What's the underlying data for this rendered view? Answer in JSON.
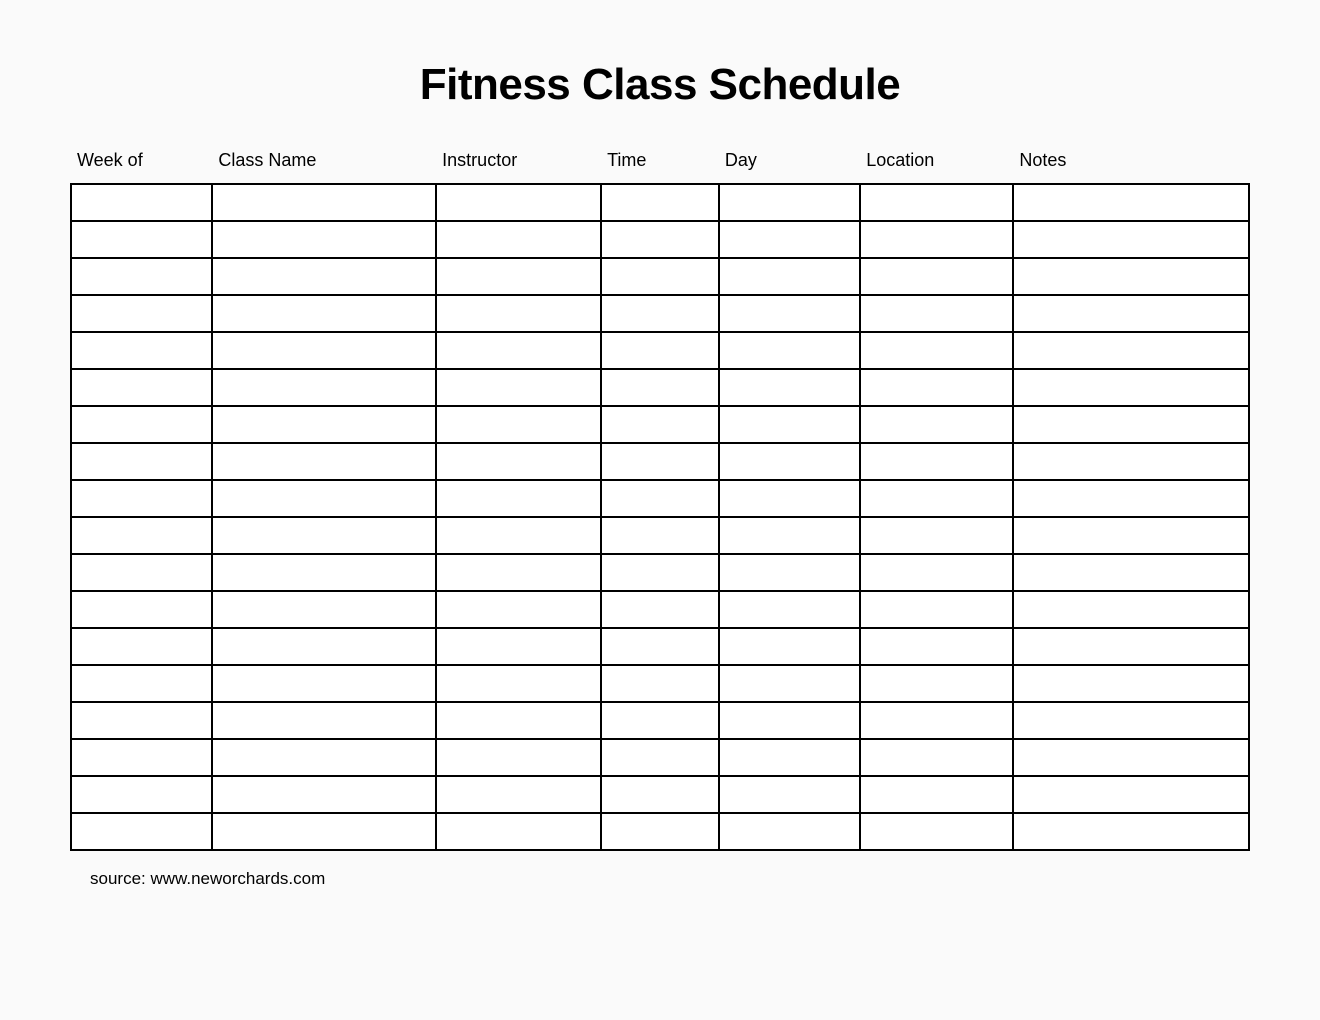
{
  "title": "Fitness Class Schedule",
  "columns": [
    "Week of",
    "Class Name",
    "Instructor",
    "Time",
    "Day",
    "Location",
    "Notes"
  ],
  "rows": [
    [
      "",
      "",
      "",
      "",
      "",
      "",
      ""
    ],
    [
      "",
      "",
      "",
      "",
      "",
      "",
      ""
    ],
    [
      "",
      "",
      "",
      "",
      "",
      "",
      ""
    ],
    [
      "",
      "",
      "",
      "",
      "",
      "",
      ""
    ],
    [
      "",
      "",
      "",
      "",
      "",
      "",
      ""
    ],
    [
      "",
      "",
      "",
      "",
      "",
      "",
      ""
    ],
    [
      "",
      "",
      "",
      "",
      "",
      "",
      ""
    ],
    [
      "",
      "",
      "",
      "",
      "",
      "",
      ""
    ],
    [
      "",
      "",
      "",
      "",
      "",
      "",
      ""
    ],
    [
      "",
      "",
      "",
      "",
      "",
      "",
      ""
    ],
    [
      "",
      "",
      "",
      "",
      "",
      "",
      ""
    ],
    [
      "",
      "",
      "",
      "",
      "",
      "",
      ""
    ],
    [
      "",
      "",
      "",
      "",
      "",
      "",
      ""
    ],
    [
      "",
      "",
      "",
      "",
      "",
      "",
      ""
    ],
    [
      "",
      "",
      "",
      "",
      "",
      "",
      ""
    ],
    [
      "",
      "",
      "",
      "",
      "",
      "",
      ""
    ],
    [
      "",
      "",
      "",
      "",
      "",
      "",
      ""
    ],
    [
      "",
      "",
      "",
      "",
      "",
      "",
      ""
    ]
  ],
  "source": "source: www.neworchards.com"
}
